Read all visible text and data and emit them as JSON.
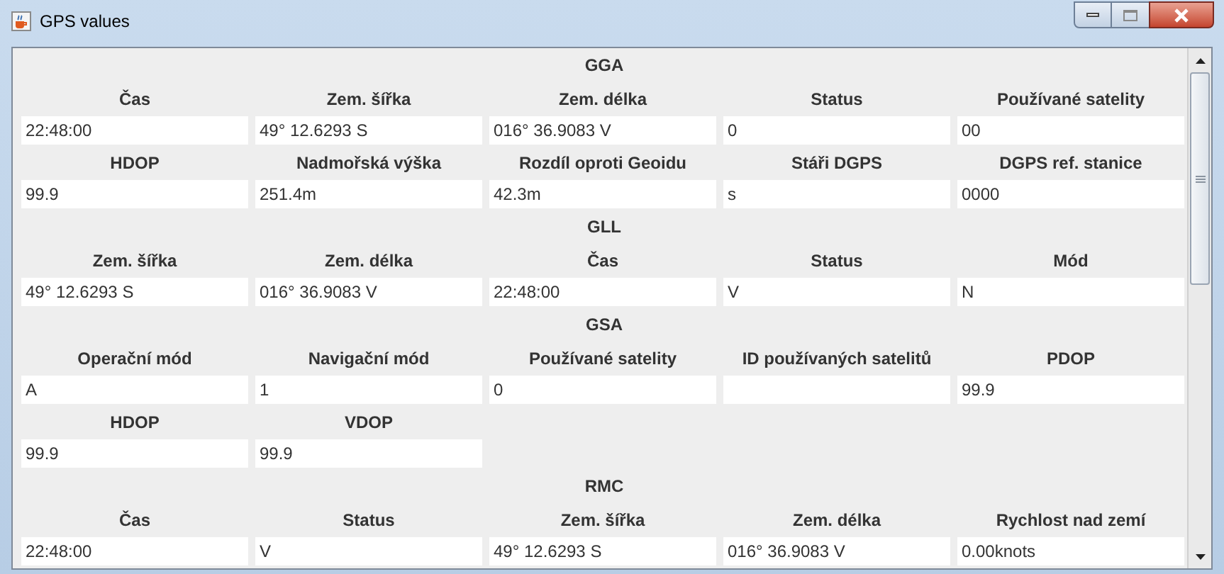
{
  "window": {
    "title": "GPS values"
  },
  "sections": [
    {
      "title": "GGA",
      "fields": [
        {
          "label": "Čas",
          "value": "22:48:00"
        },
        {
          "label": "Zem. šířka",
          "value": "49° 12.6293 S"
        },
        {
          "label": "Zem. délka",
          "value": "016° 36.9083 V"
        },
        {
          "label": "Status",
          "value": "0"
        },
        {
          "label": "Používané satelity",
          "value": "00"
        },
        {
          "label": "HDOP",
          "value": "99.9"
        },
        {
          "label": "Nadmořská výška",
          "value": "251.4m"
        },
        {
          "label": "Rozdíl oproti Geoidu",
          "value": "42.3m"
        },
        {
          "label": "Stáři DGPS",
          "value": "s"
        },
        {
          "label": "DGPS ref. stanice",
          "value": "0000"
        }
      ]
    },
    {
      "title": "GLL",
      "fields": [
        {
          "label": "Zem. šířka",
          "value": "49° 12.6293 S"
        },
        {
          "label": "Zem. délka",
          "value": "016° 36.9083 V"
        },
        {
          "label": "Čas",
          "value": "22:48:00"
        },
        {
          "label": "Status",
          "value": "V"
        },
        {
          "label": "Mód",
          "value": "N"
        }
      ]
    },
    {
      "title": "GSA",
      "fields": [
        {
          "label": "Operační mód",
          "value": "A"
        },
        {
          "label": "Navigační mód",
          "value": "1"
        },
        {
          "label": "Používané satelity",
          "value": "0"
        },
        {
          "label": "ID používaných satelitů"
        },
        {
          "label": "PDOP",
          "value": "99.9"
        },
        {
          "label": "HDOP",
          "value": "99.9"
        },
        {
          "label": "VDOP",
          "value": "99.9"
        }
      ]
    },
    {
      "title": "RMC",
      "fields": [
        {
          "label": "Čas",
          "value": "22:48:00"
        },
        {
          "label": "Status",
          "value": "V"
        },
        {
          "label": "Zem. šířka",
          "value": "49° 12.6293 S"
        },
        {
          "label": "Zem. délka",
          "value": "016° 36.9083 V"
        },
        {
          "label": "Rychlost nad zemí",
          "value": "0.00knots"
        }
      ]
    }
  ]
}
